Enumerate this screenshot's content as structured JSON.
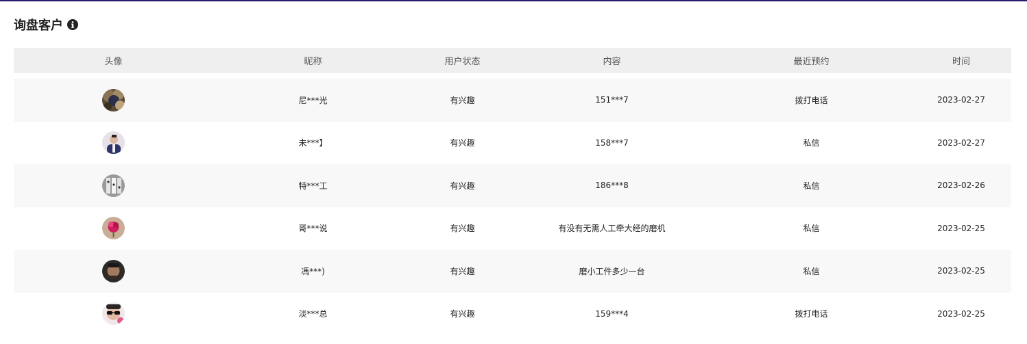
{
  "panel": {
    "title": "询盘客户",
    "info_icon": "info-circle-icon"
  },
  "table": {
    "columns": [
      "头像",
      "昵称",
      "用户状态",
      "内容",
      "最近预约",
      "时间"
    ],
    "rows": [
      {
        "avatar": "avatar-1",
        "nickname": "尼***光",
        "status": "有兴趣",
        "content": "151***7",
        "recent": "拨打电话",
        "time": "2023-02-27"
      },
      {
        "avatar": "avatar-2",
        "nickname": "未***】",
        "status": "有兴趣",
        "content": "158***7",
        "recent": "私信",
        "time": "2023-02-27"
      },
      {
        "avatar": "avatar-3",
        "nickname": "特***工",
        "status": "有兴趣",
        "content": "186***8",
        "recent": "私信",
        "time": "2023-02-26"
      },
      {
        "avatar": "avatar-4",
        "nickname": "哥***说",
        "status": "有兴趣",
        "content": "有没有无需人工牵大经的磨机",
        "recent": "私信",
        "time": "2023-02-25"
      },
      {
        "avatar": "avatar-5",
        "nickname": "馮***)",
        "status": "有兴趣",
        "content": "磨小工件多少一台",
        "recent": "私信",
        "time": "2023-02-25"
      },
      {
        "avatar": "avatar-6",
        "nickname": "淡***总",
        "status": "有兴趣",
        "content": "159***4",
        "recent": "拨打电话",
        "time": "2023-02-25"
      }
    ]
  },
  "colors": {
    "top_border": "#2a1a6e",
    "header_bg": "#efefef",
    "row_alt_bg": "#f8f8f8"
  }
}
